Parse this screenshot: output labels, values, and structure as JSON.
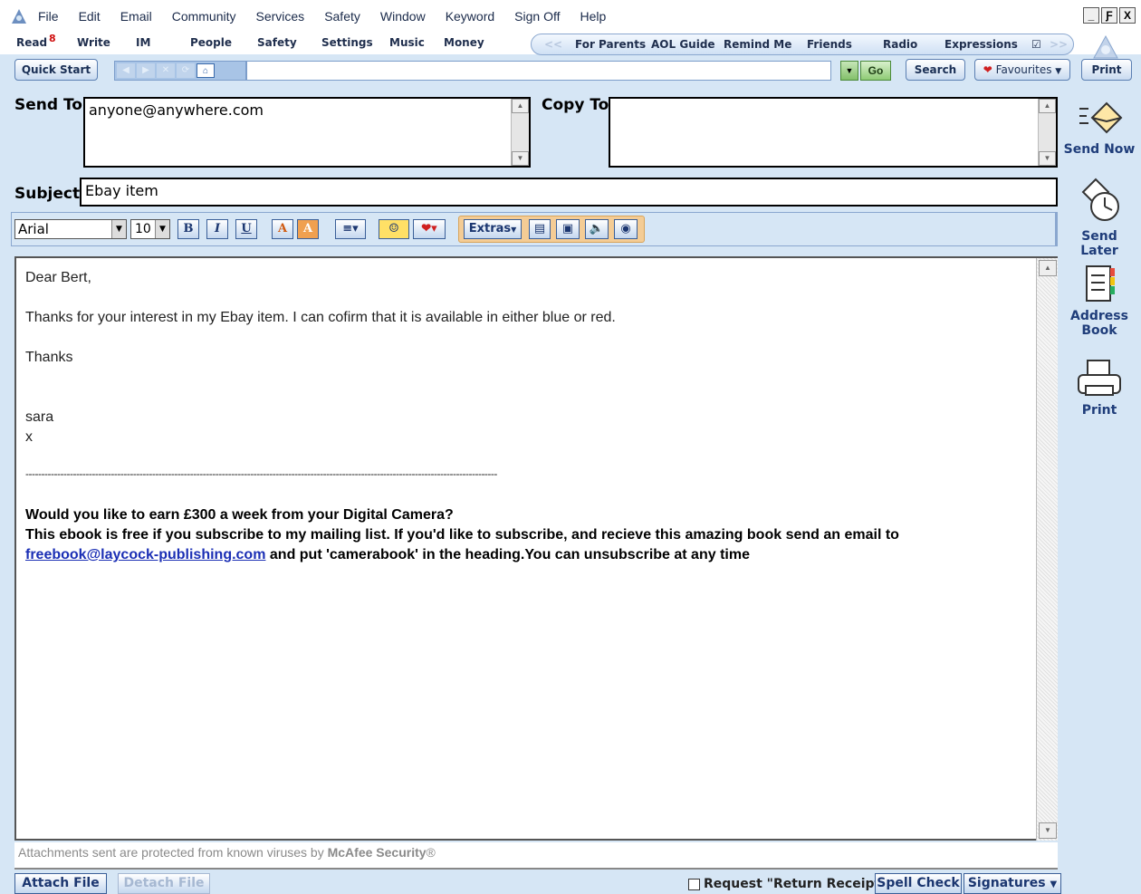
{
  "menu": [
    "File",
    "Edit",
    "Email",
    "Community",
    "Services",
    "Safety",
    "Window",
    "Keyword",
    "Sign Off",
    "Help"
  ],
  "window_controls": [
    "_",
    "Ƒ",
    "X"
  ],
  "nav": {
    "read": "Read",
    "read_badge": "8",
    "write": "Write",
    "im": "IM",
    "people": "People",
    "safety": "Safety",
    "settings": "Settings",
    "music": "Music",
    "money": "Money"
  },
  "shortcuts": {
    "for_parents": "For Parents",
    "aol_guide": "AOL Guide",
    "remind_me": "Remind Me",
    "friends": "Friends",
    "radio": "Radio",
    "expressions": "Expressions"
  },
  "toolbar": {
    "quick_start": "Quick Start",
    "address_value": "",
    "go": "Go",
    "search": "Search",
    "favourites": "Favourites",
    "print": "Print"
  },
  "compose": {
    "send_to_label": "Send To:",
    "send_to_value": "anyone@anywhere.com",
    "copy_to_label": "Copy To:",
    "copy_to_value": "",
    "subject_label": "Subject:",
    "subject_value": "Ebay item"
  },
  "format": {
    "font": "Arial",
    "size": "10",
    "bold": "B",
    "italic": "I",
    "underline": "U",
    "text_color": "A",
    "bg_color": "A",
    "extras": "Extras"
  },
  "body": {
    "greeting": "Dear Bert,",
    "line1": "Thanks for your interest in my Ebay item. I can cofirm that it is available in either blue or red.",
    "thanks": "Thanks",
    "sig_name": "sara",
    "sig_x": "x",
    "separator": "-----------------------------------------------------------------------------------------------------------------------------------------------------",
    "promo_title": "Would you like to earn £300 a week from your Digital Camera?",
    "promo_line": "This ebook is free if you subscribe to my mailing list. If you'd like to subscribe, and recieve this amazing book send an email to",
    "promo_link": "freebook@laycock-publishing.com",
    "promo_tail": "and put 'camerabook' in the heading.You can unsubscribe at any time"
  },
  "sidebar": {
    "send_now": "Send Now",
    "send_later": "Send Later",
    "address_book_1": "Address",
    "address_book_2": "Book",
    "print": "Print"
  },
  "footer": {
    "security_prefix": "Attachments sent are protected from known viruses by",
    "security_brand": "McAfee Security",
    "security_mark": "®",
    "attach": "Attach File",
    "detach": "Detach File",
    "receipt": "Request \"Return Receipt\"",
    "spell": "Spell Check",
    "signatures": "Signatures"
  }
}
